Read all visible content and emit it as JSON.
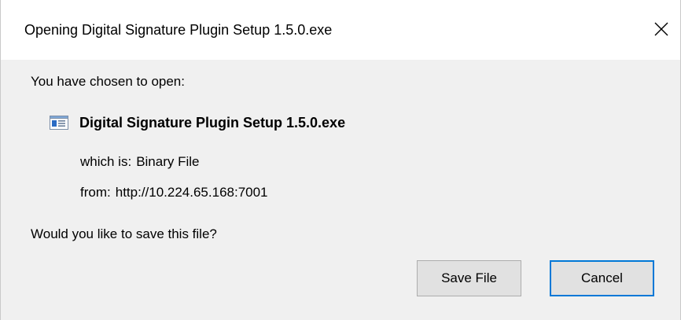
{
  "window": {
    "title": "Opening Digital Signature Plugin Setup 1.5.0.exe",
    "close_icon": "close-icon"
  },
  "body": {
    "intro": "You have chosen to open:",
    "file_icon": "exe-file-icon",
    "file_name": "Digital Signature Plugin Setup 1.5.0.exe",
    "which_label": "which is:",
    "which_value": "Binary File",
    "from_label": "from:",
    "from_value": "http://10.224.65.168:7001",
    "question": "Would you like to save this file?"
  },
  "buttons": {
    "save_label": "Save File",
    "cancel_label": "Cancel"
  },
  "colors": {
    "focus_border": "#0078d7",
    "dialog_background": "#f0f0f0",
    "titlebar_background": "#ffffff"
  }
}
